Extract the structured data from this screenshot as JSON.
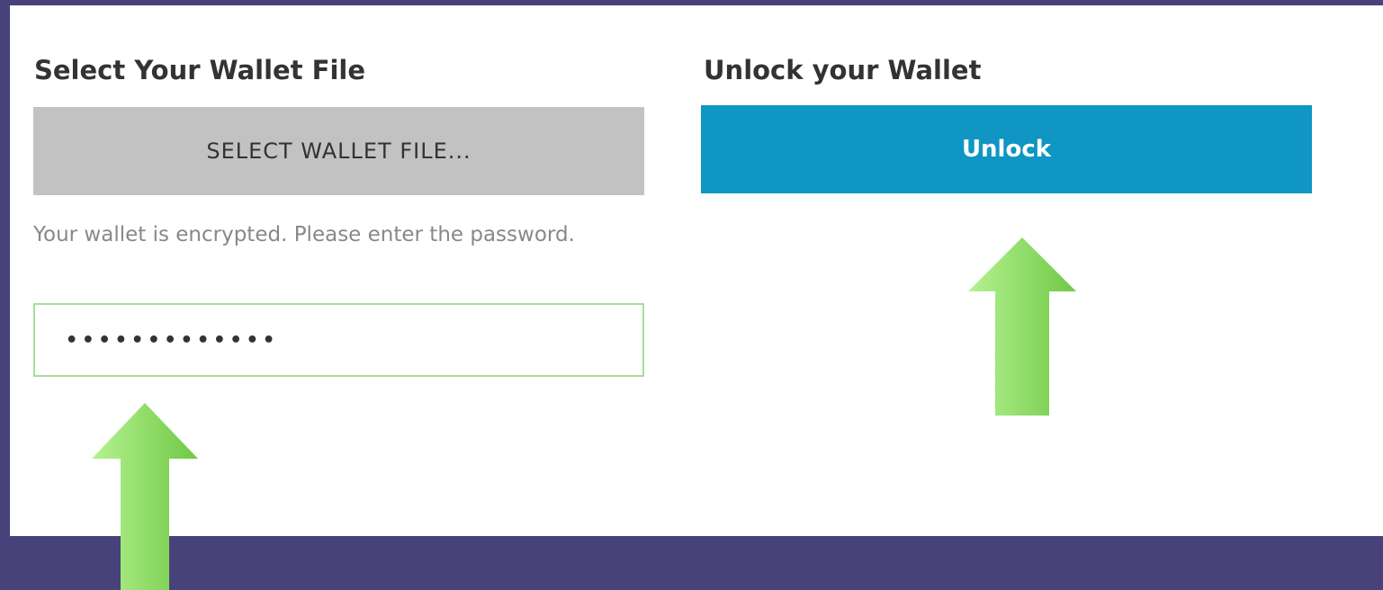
{
  "select_section": {
    "heading": "Select Your Wallet File",
    "button_label": "SELECT WALLET FILE...",
    "help_text": "Your wallet is encrypted. Please enter the password.",
    "password_value": "•••••••••••••"
  },
  "unlock_section": {
    "heading": "Unlock your Wallet",
    "button_label": "Unlock"
  },
  "colors": {
    "background": "#48427a",
    "select_button": "#c2c2c2",
    "unlock_button": "#0f96c3",
    "field_border": "#a7dd9a",
    "arrow": "#86d65a"
  },
  "annotations": [
    {
      "icon": "arrow-up-icon",
      "points_to": "password-field"
    },
    {
      "icon": "arrow-up-icon",
      "points_to": "unlock-button"
    }
  ]
}
